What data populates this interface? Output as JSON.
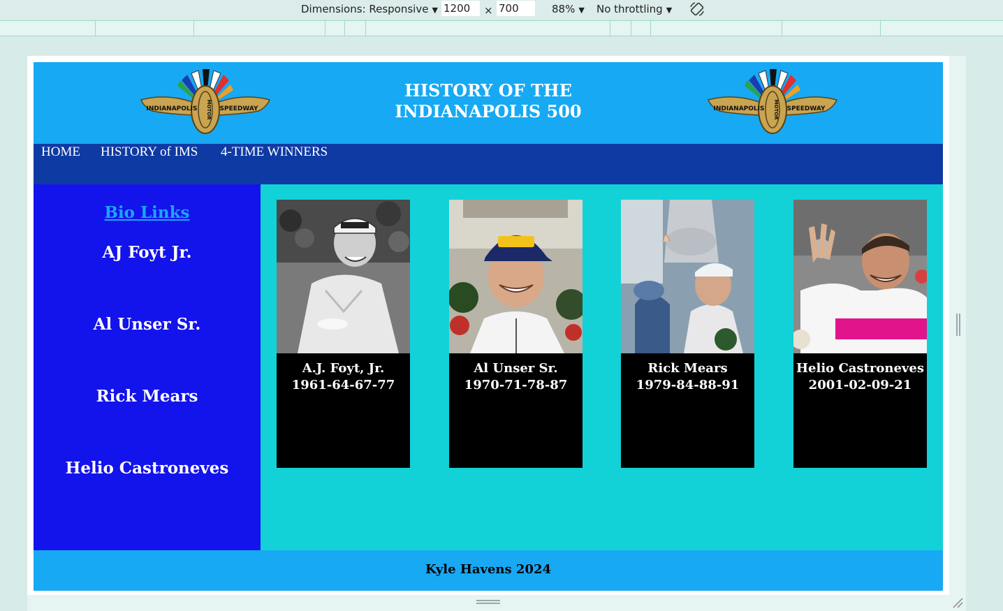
{
  "devtools": {
    "dimensions_label": "Dimensions: Responsive",
    "width": "1200",
    "times": "×",
    "height": "700",
    "zoom": "88%",
    "throttling": "No throttling"
  },
  "site": {
    "title_line1": "HISTORY OF THE",
    "title_line2": "INDIANAPOLIS 500",
    "logo_text_left": "INDIANAPOLIS",
    "logo_text_center": "MOTOR",
    "logo_text_right": "SPEEDWAY"
  },
  "nav": [
    "HOME",
    "HISTORY of IMS",
    "4-TIME WINNERS"
  ],
  "sidebar": {
    "heading": "Bio Links",
    "links": [
      "AJ Foyt Jr.",
      "Al Unser Sr.",
      "Rick Mears",
      "Helio Castroneves"
    ]
  },
  "cards": [
    {
      "name": "A.J. Foyt, Jr.",
      "years": "1961-64-67-77"
    },
    {
      "name": "Al Unser Sr.",
      "years": "1970-71-78-87"
    },
    {
      "name": "Rick Mears",
      "years": "1979-84-88-91"
    },
    {
      "name": "Helio Castroneves",
      "years": "2001-02-09-21"
    }
  ],
  "footer": "Kyle Havens 2024",
  "colors": {
    "header": "#17a9f3",
    "nav": "#0e3aa3",
    "sidebar": "#1313ec",
    "main": "#12d2d8",
    "card": "#000000"
  }
}
